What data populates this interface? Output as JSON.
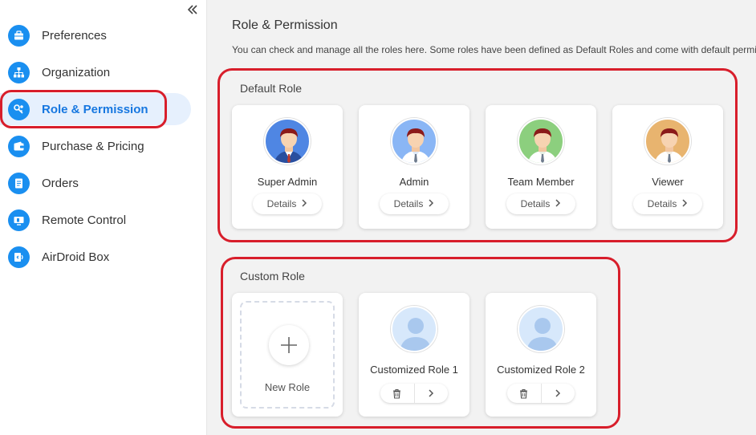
{
  "sidebar": {
    "collapse_icon": "double-chevron-left-icon",
    "items": [
      {
        "label": "Preferences",
        "icon": "briefcase-icon"
      },
      {
        "label": "Organization",
        "icon": "org-chart-icon"
      },
      {
        "label": "Role & Permission",
        "icon": "key-gear-icon",
        "active": true
      },
      {
        "label": "Purchase & Pricing",
        "icon": "wallet-icon"
      },
      {
        "label": "Orders",
        "icon": "document-list-icon"
      },
      {
        "label": "Remote Control",
        "icon": "remote-screen-icon"
      },
      {
        "label": "AirDroid Box",
        "icon": "box-device-icon"
      }
    ]
  },
  "main": {
    "title": "Role & Permission",
    "description": "You can check and manage all the roles here. Some roles have been defined as Default Roles and come with default permi",
    "default_roles": {
      "title": "Default Role",
      "details_label": "Details",
      "roles": [
        {
          "name": "Super Admin",
          "avatar_bg": "#4f86e3"
        },
        {
          "name": "Admin",
          "avatar_bg": "#8ab6f5"
        },
        {
          "name": "Team Member",
          "avatar_bg": "#8ccf7e"
        },
        {
          "name": "Viewer",
          "avatar_bg": "#e8b46f"
        }
      ]
    },
    "custom_roles": {
      "title": "Custom Role",
      "new_role_label": "New Role",
      "roles": [
        {
          "name": "Customized Role 1"
        },
        {
          "name": "Customized Role 2"
        }
      ]
    }
  },
  "colors": {
    "accent": "#1a8ff0",
    "highlight": "#d81e2b",
    "active_bg": "#e6f0fd"
  }
}
